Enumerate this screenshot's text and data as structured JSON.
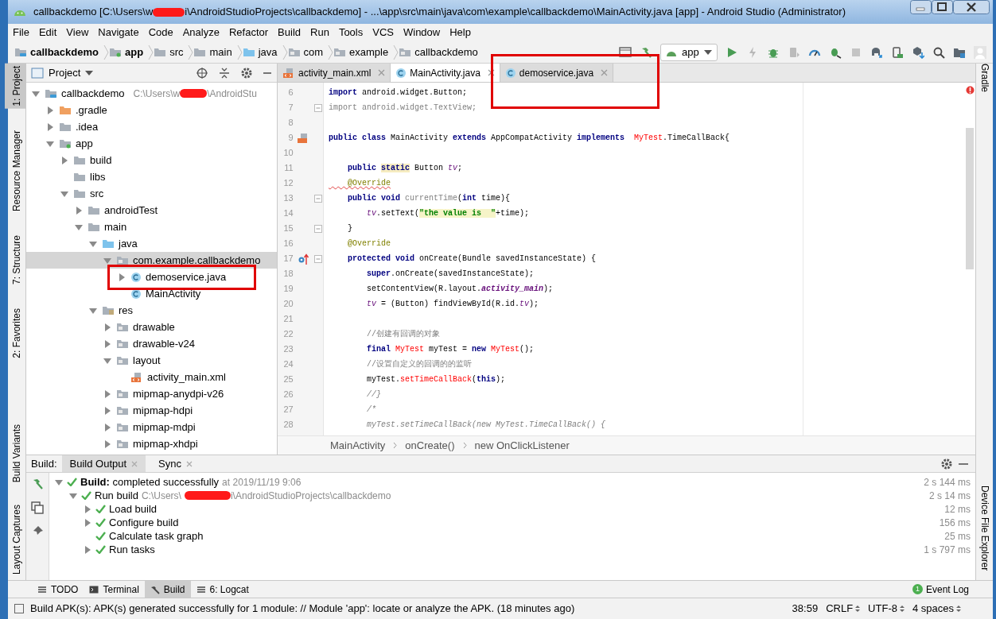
{
  "window": {
    "title_start": "callbackdemo [C:\\Users\\w",
    "title_end": "i\\AndroidStudioProjects\\callbackdemo] - ...\\app\\src\\main\\java\\com\\example\\callbackdemo\\MainActivity.java [app] - Android Studio (Administrator)"
  },
  "menu": [
    "File",
    "Edit",
    "View",
    "Navigate",
    "Code",
    "Analyze",
    "Refactor",
    "Build",
    "Run",
    "Tools",
    "VCS",
    "Window",
    "Help"
  ],
  "nav_path": [
    {
      "label": "callbackdemo",
      "bold": true,
      "kind": "project"
    },
    {
      "label": "app",
      "bold": true,
      "kind": "module"
    },
    {
      "label": "src",
      "bold": false,
      "kind": "folder"
    },
    {
      "label": "main",
      "bold": false,
      "kind": "folder"
    },
    {
      "label": "java",
      "bold": false,
      "kind": "source"
    },
    {
      "label": "com",
      "bold": false,
      "kind": "package"
    },
    {
      "label": "example",
      "bold": false,
      "kind": "package"
    },
    {
      "label": "callbackdemo",
      "bold": false,
      "kind": "package"
    }
  ],
  "run_config": {
    "label": "app"
  },
  "left_tool_strip": [
    {
      "label": "1: Project",
      "selected": true
    },
    {
      "label": "Resource Manager",
      "selected": false
    },
    {
      "label": "7: Structure",
      "selected": false
    },
    {
      "label": "2: Favorites",
      "selected": false
    },
    {
      "label": "Build Variants",
      "selected": false
    },
    {
      "label": "Layout Captures",
      "selected": false
    }
  ],
  "right_tool_strip": [
    {
      "label": "Gradle"
    },
    {
      "label": "Device File Explorer"
    }
  ],
  "project_panel": {
    "title": "Project",
    "tree": [
      {
        "label": "callbackdemo",
        "kind": "project",
        "expanded": true,
        "selected": false,
        "path_start": "C:\\Users\\w",
        "path_end": "\\AndroidStu",
        "children": [
          {
            "label": ".gradle",
            "kind": "folder_orange",
            "expanded": false,
            "selected": false
          },
          {
            "label": ".idea",
            "kind": "folder",
            "expanded": false,
            "selected": false
          },
          {
            "label": "app",
            "kind": "module",
            "expanded": true,
            "selected": false,
            "children": [
              {
                "label": "build",
                "kind": "folder",
                "expanded": false,
                "selected": false
              },
              {
                "label": "libs",
                "kind": "folder",
                "selected": false
              },
              {
                "label": "src",
                "kind": "folder",
                "expanded": true,
                "selected": false,
                "children": [
                  {
                    "label": "androidTest",
                    "kind": "folder",
                    "expanded": false,
                    "selected": false
                  },
                  {
                    "label": "main",
                    "kind": "folder",
                    "expanded": true,
                    "selected": false,
                    "children": [
                      {
                        "label": "java",
                        "kind": "source",
                        "expanded": true,
                        "selected": false,
                        "children": [
                          {
                            "label": "com.example.callbackdemo",
                            "kind": "package",
                            "expanded": true,
                            "selected": true,
                            "children": [
                              {
                                "label": "demoservice.java",
                                "kind": "class",
                                "expanded": false,
                                "selected": false
                              },
                              {
                                "label": "MainActivity",
                                "kind": "class",
                                "selected": false
                              }
                            ]
                          }
                        ]
                      },
                      {
                        "label": "res",
                        "kind": "resources",
                        "expanded": true,
                        "selected": false,
                        "children": [
                          {
                            "label": "drawable",
                            "kind": "package",
                            "expanded": false,
                            "selected": false
                          },
                          {
                            "label": "drawable-v24",
                            "kind": "package",
                            "expanded": false,
                            "selected": false
                          },
                          {
                            "label": "layout",
                            "kind": "package",
                            "expanded": true,
                            "selected": false,
                            "children": [
                              {
                                "label": "activity_main.xml",
                                "kind": "xml",
                                "selected": false
                              }
                            ]
                          },
                          {
                            "label": "mipmap-anydpi-v26",
                            "kind": "package",
                            "expanded": false,
                            "selected": false
                          },
                          {
                            "label": "mipmap-hdpi",
                            "kind": "package",
                            "expanded": false,
                            "selected": false
                          },
                          {
                            "label": "mipmap-mdpi",
                            "kind": "package",
                            "expanded": false,
                            "selected": false
                          },
                          {
                            "label": "mipmap-xhdpi",
                            "kind": "package",
                            "expanded": false,
                            "selected": false
                          }
                        ]
                      }
                    ]
                  }
                ]
              }
            ]
          }
        ]
      }
    ]
  },
  "editor_tabs": [
    {
      "label": "activity_main.xml",
      "kind": "xml",
      "selected": false
    },
    {
      "label": "MainActivity.java",
      "kind": "class",
      "selected": true
    },
    {
      "label": "demoservice.java",
      "kind": "class",
      "selected": false
    }
  ],
  "code_lines": [
    {
      "number": "6",
      "kind": "plain",
      "fold": false,
      "tokens": [
        {
          "kind": "kw",
          "text": "import"
        },
        {
          "kind": "plain",
          "text": " android.widget.Button;"
        }
      ]
    },
    {
      "number": "7",
      "kind": "plain",
      "fold": true,
      "tokens": [
        {
          "kind": "unused",
          "text": "import android.widget.TextView;"
        }
      ]
    },
    {
      "number": "8",
      "kind": "plain",
      "fold": false
    },
    {
      "number": "9",
      "kind": "layout_marker",
      "fold": false,
      "tokens": [
        {
          "kind": "kw",
          "text": "public class"
        },
        {
          "kind": "plain",
          "text": " MainActivity "
        },
        {
          "kind": "kw",
          "text": "extends"
        },
        {
          "kind": "plain",
          "text": " AppCompatActivity "
        },
        {
          "kind": "kw",
          "text": "implements  "
        },
        {
          "kind": "err",
          "text": "MyTest"
        },
        {
          "kind": "plain",
          "text": ".TimeCallBack{"
        }
      ]
    },
    {
      "number": "10",
      "kind": "plain",
      "fold": false
    },
    {
      "number": "11",
      "kind": "plain",
      "fold": false,
      "tokens": [
        {
          "kind": "kw",
          "text": "    public "
        },
        {
          "kind": "kwhl",
          "text": "static"
        },
        {
          "kind": "plain",
          "text": " Button "
        },
        {
          "kind": "field",
          "text": "tv"
        },
        {
          "kind": "plain",
          "text": ";"
        }
      ]
    },
    {
      "number": "12",
      "kind": "plain",
      "fold": false,
      "tokens": [
        {
          "kind": "annwarn",
          "text": "    @Override"
        }
      ]
    },
    {
      "number": "13",
      "kind": "plain",
      "fold": true,
      "tokens": [
        {
          "kind": "kw",
          "text": "    public void "
        },
        {
          "kind": "unused",
          "text": "currentTime"
        },
        {
          "kind": "plain",
          "text": "("
        },
        {
          "kind": "kw",
          "text": "int"
        },
        {
          "kind": "plain",
          "text": " time){"
        }
      ]
    },
    {
      "number": "14",
      "kind": "plain",
      "fold": false,
      "tokens": [
        {
          "kind": "field",
          "text": "        tv"
        },
        {
          "kind": "plain",
          "text": ".setText("
        },
        {
          "kind": "str",
          "text": "\"the value is  \""
        },
        {
          "kind": "plain",
          "text": "+time);"
        }
      ]
    },
    {
      "number": "15",
      "kind": "plain",
      "fold": true,
      "tokens": [
        {
          "kind": "plain",
          "text": "    }"
        }
      ]
    },
    {
      "number": "16",
      "kind": "plain",
      "fold": false,
      "tokens": [
        {
          "kind": "ann",
          "text": "    @Override"
        }
      ]
    },
    {
      "number": "17",
      "kind": "override_marker",
      "fold": true,
      "tokens": [
        {
          "kind": "kw",
          "text": "    protected void"
        },
        {
          "kind": "plain",
          "text": " onCreate(Bundle savedInstanceState) {"
        }
      ]
    },
    {
      "number": "18",
      "kind": "plain",
      "fold": false,
      "tokens": [
        {
          "kind": "kw",
          "text": "        super"
        },
        {
          "kind": "plain",
          "text": ".onCreate(savedInstanceState);"
        }
      ]
    },
    {
      "number": "19",
      "kind": "plain",
      "fold": false,
      "tokens": [
        {
          "kind": "plain",
          "text": "        setContentView(R.layout."
        },
        {
          "kind": "sfield",
          "text": "activity_main"
        },
        {
          "kind": "plain",
          "text": ");"
        }
      ]
    },
    {
      "number": "20",
      "kind": "plain",
      "fold": false,
      "tokens": [
        {
          "kind": "field",
          "text": "        tv"
        },
        {
          "kind": "plain",
          "text": " = (Button) findViewById(R.id."
        },
        {
          "kind": "field",
          "text": "tv"
        },
        {
          "kind": "plain",
          "text": ");"
        }
      ]
    },
    {
      "number": "21",
      "kind": "plain",
      "fold": false
    },
    {
      "number": "22",
      "kind": "plain",
      "fold": false,
      "tokens": [
        {
          "kind": "cmt",
          "text": "        //创建有回调的对象"
        }
      ]
    },
    {
      "number": "23",
      "kind": "plain",
      "fold": false,
      "tokens": [
        {
          "kind": "kw",
          "text": "        final "
        },
        {
          "kind": "err",
          "text": "MyTest"
        },
        {
          "kind": "plain",
          "text": " myTest = "
        },
        {
          "kind": "kw",
          "text": "new "
        },
        {
          "kind": "err",
          "text": "MyTest"
        },
        {
          "kind": "plain",
          "text": "();"
        }
      ]
    },
    {
      "number": "24",
      "kind": "plain",
      "fold": false,
      "tokens": [
        {
          "kind": "cmt",
          "text": "        //设置自定义的回调的的监听"
        }
      ]
    },
    {
      "number": "25",
      "kind": "plain",
      "fold": false,
      "tokens": [
        {
          "kind": "plain",
          "text": "        myTest."
        },
        {
          "kind": "err",
          "text": "setTimeCallBack"
        },
        {
          "kind": "plain",
          "text": "("
        },
        {
          "kind": "kw",
          "text": "this"
        },
        {
          "kind": "plain",
          "text": ");"
        }
      ]
    },
    {
      "number": "26",
      "kind": "plain",
      "fold": false,
      "tokens": [
        {
          "kind": "cmti",
          "text": "        //}"
        }
      ]
    },
    {
      "number": "27",
      "kind": "plain",
      "fold": false,
      "tokens": [
        {
          "kind": "cmti",
          "text": "        /*"
        }
      ]
    },
    {
      "number": "28",
      "kind": "plain",
      "fold": false,
      "tokens": [
        {
          "kind": "cmti",
          "text": "        myTest.setTimeCallBack(new MyTest.TimeCallBack() {"
        }
      ]
    }
  ],
  "editor_breadcrumb": [
    "MainActivity",
    "onCreate()",
    "new OnClickListener"
  ],
  "build_panel": {
    "label": "Build:",
    "tabs": [
      {
        "label": "Build Output",
        "selected": true
      },
      {
        "label": "Sync",
        "selected": false
      }
    ],
    "tree": [
      {
        "label": "**Build:** completed successfully",
        "detail": "at 2019/11/19 9:06",
        "time": "2 s 144 ms",
        "expanded": true,
        "children": [
          {
            "label": "Run build",
            "detail_start": "C:\\Users\\",
            "detail_end": "i\\AndroidStudioProjects\\callbackdemo",
            "time": "2 s 14 ms",
            "expanded": true,
            "children": [
              {
                "label": "Load build",
                "time": "12 ms",
                "expanded": false
              },
              {
                "label": "Configure build",
                "time": "156 ms",
                "expanded": false
              },
              {
                "label": "Calculate task graph",
                "time": "25 ms"
              },
              {
                "label": "Run tasks",
                "time": "1 s 797 ms",
                "expanded": false
              }
            ]
          }
        ]
      }
    ]
  },
  "bottom_tabs": [
    {
      "label": "TODO",
      "kind": "list",
      "selected": false
    },
    {
      "label": "Terminal",
      "kind": "terminal",
      "selected": false
    },
    {
      "label": "Build",
      "kind": "hammer",
      "selected": true
    },
    {
      "label": "6: Logcat",
      "kind": "list",
      "selected": false
    }
  ],
  "event_log": {
    "label": "Event Log",
    "count": "1"
  },
  "status_bar": {
    "message": "Build APK(s): APK(s) generated successfully for 1 module: // Module 'app': locate or analyze the APK. (18 minutes ago)",
    "position": "38:59",
    "line_separator": "CRLF",
    "encoding": "UTF-8",
    "indent": "4 spaces"
  }
}
